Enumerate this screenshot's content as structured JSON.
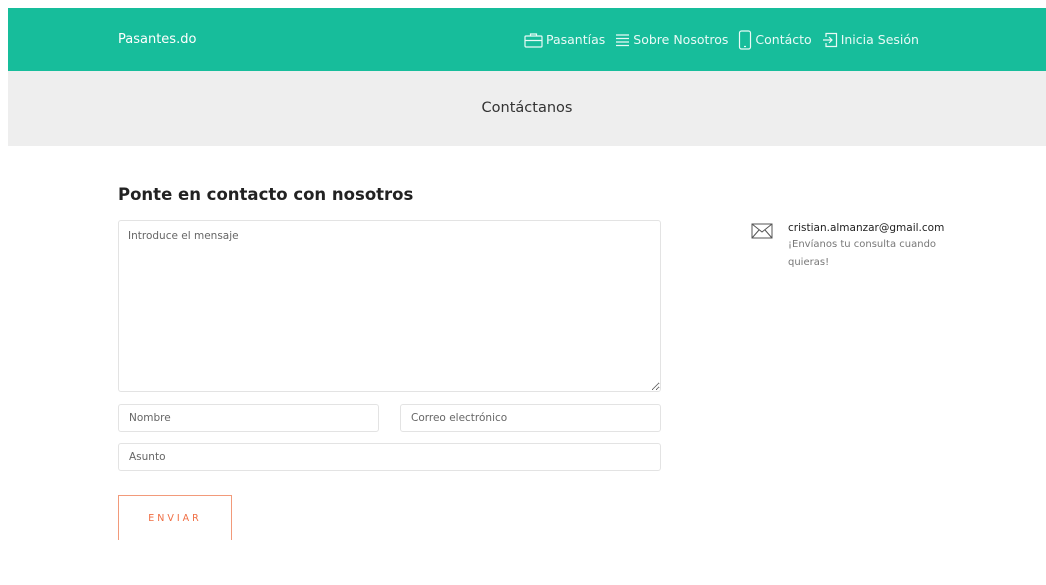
{
  "nav": {
    "brand": "Pasantes.do",
    "items": [
      {
        "label": "Pasantías",
        "icon": "briefcase-icon"
      },
      {
        "label": "Sobre Nosotros",
        "icon": "menu-lines-icon"
      },
      {
        "label": "Contácto",
        "icon": "smartphone-icon"
      },
      {
        "label": "Inicia Sesión",
        "icon": "sign-in-icon"
      }
    ]
  },
  "banner": {
    "title": "Contáctanos"
  },
  "form": {
    "title": "Ponte en contacto con nosotros",
    "message_placeholder": "Introduce el mensaje",
    "name_placeholder": "Nombre",
    "email_placeholder": "Correo electrónico",
    "subject_placeholder": "Asunto",
    "submit_label": "ENVIAR"
  },
  "contact": {
    "email": "cristian.almanzar@gmail.com",
    "note": "¡Envíanos tu consulta cuando quieras!",
    "icon": "envelope-icon"
  },
  "colors": {
    "navbar": "#17bd9b",
    "banner": "#eeeeee",
    "button_accent": "#f06d42"
  }
}
